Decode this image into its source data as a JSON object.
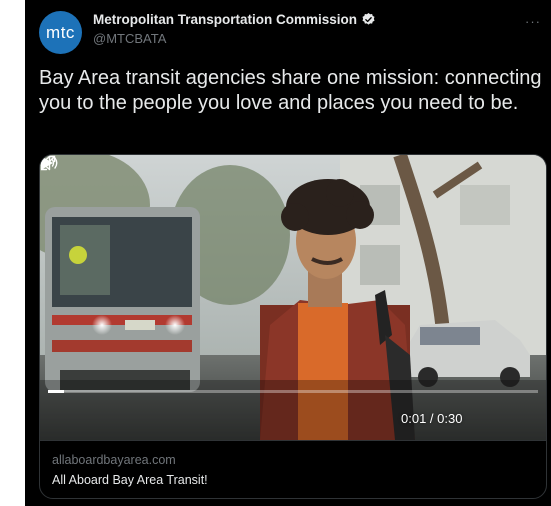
{
  "tweet": {
    "avatar_text": "mtc",
    "display_name": "Metropolitan Transportation Commission",
    "handle": "@MTCBATA",
    "more_label": "···",
    "text": "Bay Area transit agencies share one mission: connecting you to the people you love and places you need to be."
  },
  "video": {
    "current_time": "0:01",
    "duration": "0:30",
    "time_display": "0:01 / 0:30",
    "progress_fraction": 0.033
  },
  "card": {
    "domain": "allaboardbayarea.com",
    "title": "All Aboard Bay Area Transit!"
  },
  "colors": {
    "background": "#000000",
    "text": "#e7e9ea",
    "secondary_text": "#71767b",
    "verified": "#e7e9ea",
    "avatar": "#1d72b8"
  },
  "icons": {
    "verified": "verified-badge-icon",
    "more": "more-icon",
    "play": "play-icon",
    "volume": "volume-icon",
    "fullscreen": "fullscreen-icon"
  }
}
